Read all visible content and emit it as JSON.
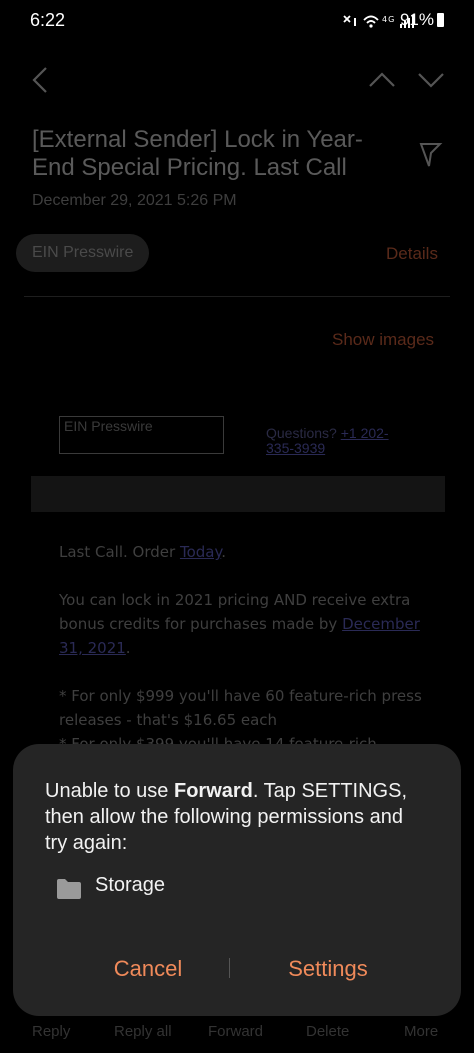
{
  "status_bar": {
    "time": "6:22",
    "network": "4G",
    "battery": "91%"
  },
  "email": {
    "subject": "[External Sender] Lock in Year-End Special Pricing. Last Call",
    "date": "December 29, 2021  5:26 PM",
    "sender": "EIN Presswire",
    "details_label": "Details",
    "show_images_label": "Show images",
    "logo_alt": "EIN Presswire",
    "questions_label": "Questions?",
    "questions_phone": "+1 202-335-3939",
    "para1_text": "Last Call. Order ",
    "para1_link": "Today",
    "para1_end": ".",
    "para2_text": "You can lock in 2021 pricing AND receive extra bonus credits for purchases made by ",
    "para2_link": "December 31, 2021",
    "para2_end": ".",
    "para3": "* For only $999 you'll have 60 feature-rich press releases - that's $16.65 each",
    "para4_partial": "* For only $399 you'll have 14 feature-rich"
  },
  "bottom_bar": [
    "Reply",
    "Reply all",
    "Forward",
    "Delete",
    "More"
  ],
  "dialog": {
    "msg_prefix": "Unable to use ",
    "msg_bold": "Forward",
    "msg_suffix": ". Tap SETTINGS, then allow the following permissions and try again:",
    "permission": "Storage",
    "cancel_label": "Cancel",
    "settings_label": "Settings"
  },
  "colors": {
    "accent": "#f08a5a",
    "dialog_bg": "#252525",
    "background": "#000000"
  }
}
